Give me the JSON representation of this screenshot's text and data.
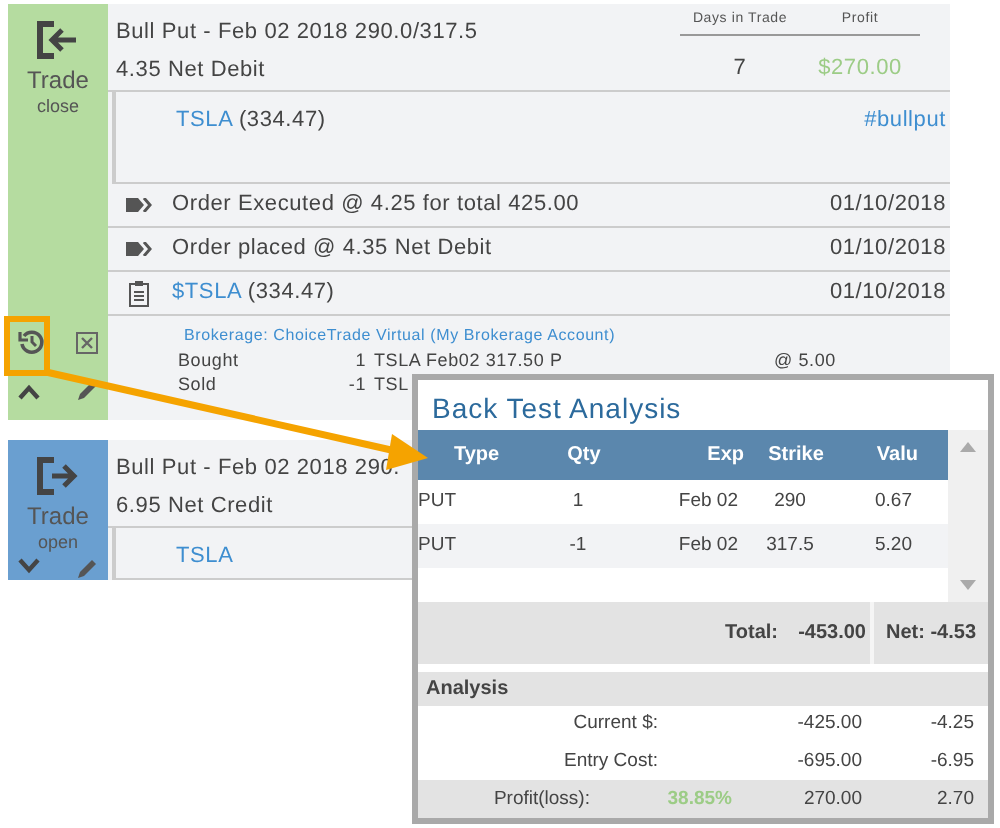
{
  "cards": [
    {
      "color": "#b5dca0",
      "action": "Trade",
      "state": "close",
      "title": "Bull Put - Feb 02 2018 290.0/317.5",
      "subtitle": "4.35 Net Debit",
      "stats": [
        {
          "label": "Days in Trade",
          "value": "7"
        },
        {
          "label": "Profit",
          "value": "$270.00"
        }
      ],
      "symbol": "TSLA",
      "price": "(334.47)",
      "tag": "#bullput",
      "events": [
        {
          "kind": "order",
          "text": "Order Executed @ 4.25 for total 425.00",
          "date": "01/10/2018"
        },
        {
          "kind": "order",
          "text": "Order placed @ 4.35 Net Debit",
          "date": "01/10/2018"
        },
        {
          "kind": "note",
          "symbol": "$TSLA",
          "text": "(334.47)",
          "date": "01/10/2018"
        }
      ],
      "brokerage": "Brokerage: ChoiceTrade Virtual (My Brokerage Account)",
      "legs": [
        {
          "action": "Bought",
          "qty": "1",
          "desc": "TSLA Feb02 317.50 P",
          "price": "@ 5.00"
        },
        {
          "action": "Sold",
          "qty": "-1",
          "desc": "TSL"
        }
      ]
    },
    {
      "color": "#6a9fd0",
      "action": "Trade",
      "state": "open",
      "title": "Bull Put - Feb 02 2018 290.",
      "subtitle": "6.95 Net Credit",
      "symbol": "TSLA"
    }
  ],
  "popup": {
    "title": "Back Test Analysis",
    "columns": [
      "Type",
      "Qty",
      "Exp",
      "Strike",
      "Valu"
    ],
    "rows": [
      [
        "PUT",
        "1",
        "Feb 02",
        "290",
        "0.67"
      ],
      [
        "PUT",
        "-1",
        "Feb 02",
        "317.5",
        "5.20"
      ]
    ],
    "total_label": "Total:",
    "total": "-453.00",
    "net": "Net: -4.53",
    "analysis_title": "Analysis",
    "analysis": [
      {
        "kind": "plain",
        "label": "Current $:",
        "total": "-425.00",
        "per": "-4.25"
      },
      {
        "kind": "plain",
        "label": "Entry Cost:",
        "total": "-695.00",
        "per": "-6.95"
      },
      {
        "kind": "result",
        "label": "Profit(loss):",
        "pct": "38.85%",
        "total": "270.00",
        "per": "2.70"
      }
    ]
  }
}
